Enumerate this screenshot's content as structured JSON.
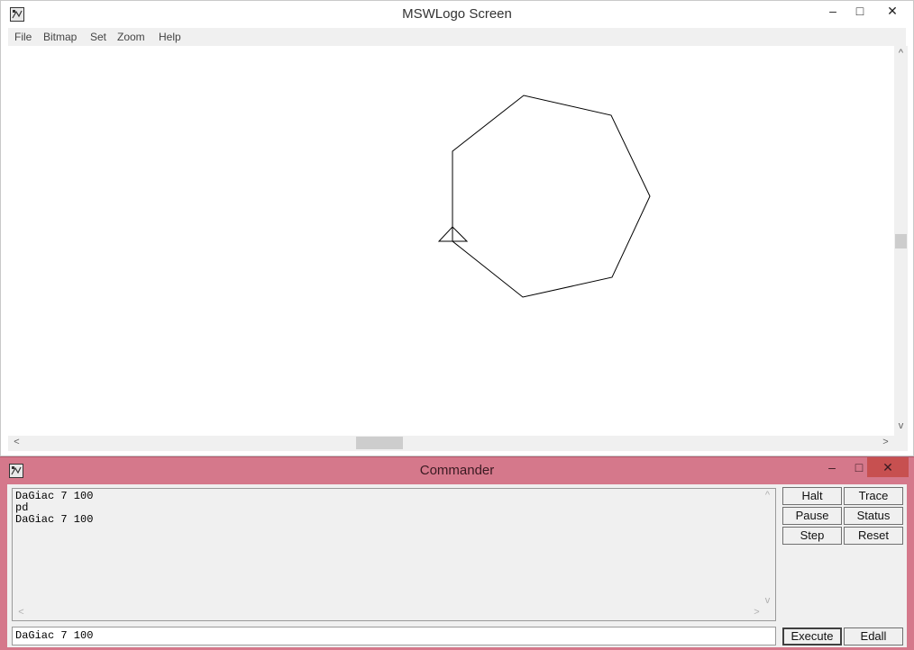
{
  "main_window": {
    "title": "MSWLogo Screen",
    "controls": {
      "minimize": "–",
      "maximize": "□",
      "close": "✕"
    },
    "menu": [
      "File",
      "Bitmap",
      "Set",
      "Zoom",
      "Help"
    ]
  },
  "commander": {
    "title": "Commander",
    "controls": {
      "minimize": "–",
      "maximize": "□",
      "close": "✕"
    },
    "history": [
      "DaGiac 7 100",
      "pd",
      "DaGiac 7 100"
    ],
    "input_value": "DaGiac 7 100",
    "buttons": {
      "halt": "Halt",
      "trace": "Trace",
      "pause": "Pause",
      "status": "Status",
      "step": "Step",
      "reset": "Reset",
      "execute": "Execute",
      "edall": "Edall"
    },
    "accent_color": "#d5788b"
  },
  "scroll_arrows": {
    "up": "^",
    "down": "v",
    "left": "<",
    "right": ">"
  }
}
